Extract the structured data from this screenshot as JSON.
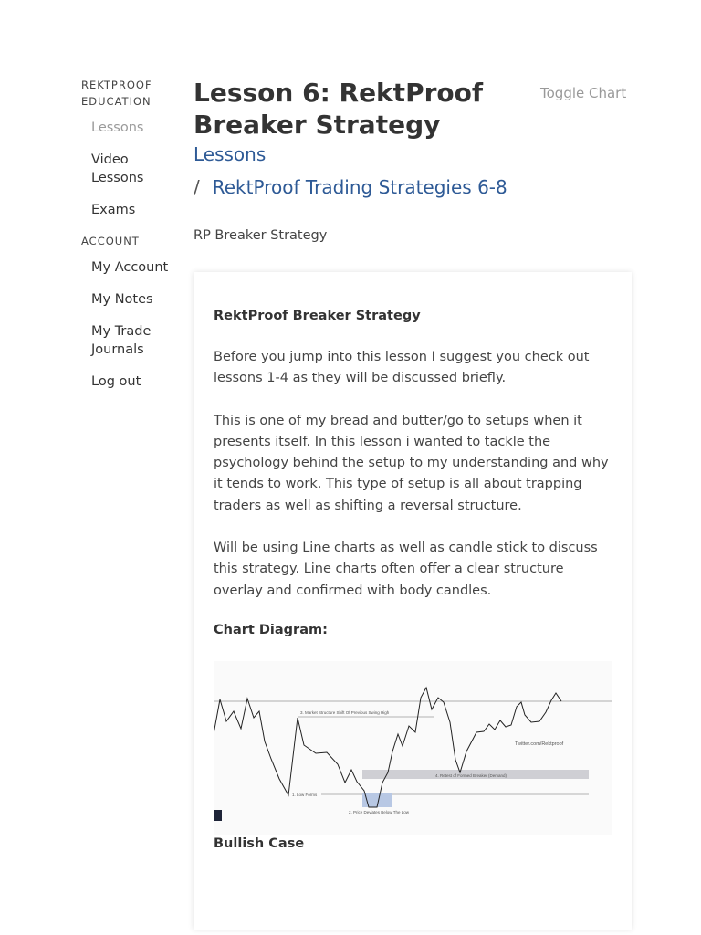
{
  "sidebar": {
    "education_title": "REKTPROOF EDUCATION",
    "education_items": [
      {
        "label": "Lessons",
        "active": true
      },
      {
        "label": "Video Lessons"
      },
      {
        "label": "Exams"
      }
    ],
    "account_title": "ACCOUNT",
    "account_items": [
      {
        "label": "My Account"
      },
      {
        "label": "My Notes"
      },
      {
        "label": "My Trade Journals"
      },
      {
        "label": "Log out"
      }
    ]
  },
  "header": {
    "title": "Lesson 6: RektProof Breaker Strategy",
    "toggle_label": "Toggle Chart",
    "breadcrumb": [
      "Lessons",
      "RektProof Trading Strategies 6-8"
    ],
    "breadcrumb_separator": "/",
    "subtitle": "RP Breaker Strategy"
  },
  "content": {
    "heading": "RektProof Breaker Strategy",
    "paragraphs": [
      "Before you jump into this lesson I suggest you check out lessons 1-4 as they will be discussed briefly.",
      "This is one of my bread and butter/go to setups when it presents itself. In this lesson i wanted to tackle the psychology behind the setup to my understanding and why it tends to work. This type of setup is all about trapping traders as well as shifting a reversal structure.",
      "Will be using Line charts as well as candle stick to discuss this strategy. Line charts often offer a clear structure overlay and confirmed with body candles."
    ],
    "chart_heading": "Chart Diagram:",
    "chart": {
      "annotations": [
        "3. Market Structure Shift Of Previous Swing High",
        "Twitter.com/Rektproof",
        "4. Retest of Formed Breaker (Demand)",
        "1. Low Forms",
        "2. Price Deviates Below The Low"
      ]
    },
    "next_heading": "Bullish Case"
  },
  "colors": {
    "link": "#2e5a96",
    "muted": "#9a9a9a",
    "zone": "#cfcfd4",
    "deviation_zone": "#b8c8e4"
  }
}
